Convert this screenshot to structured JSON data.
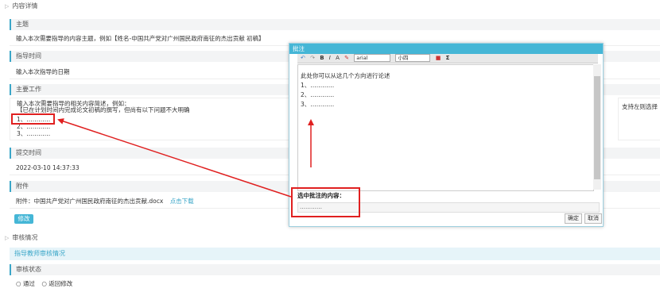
{
  "content_detail": {
    "section_title": "内容详情",
    "topic_label": "主题",
    "topic_value": "输入本次需要指导的内容主题，例如【姓名-中国共产党对广州国民政府南征的杰出贡献 初稿】",
    "guide_time_label": "指导时间",
    "guide_time_value": "输入本次指导的日期",
    "main_work_label": "主要工作",
    "main_work_lines": [
      "输入本次需要指导的相关内容简述，例如：",
      "【已在计划时间内完成论文初稿的撰写，但尚有以下问题不大明确",
      "1、…………",
      "2、…………",
      "3、…………"
    ],
    "side_note": "支持左则选择",
    "submit_time_label": "提交时间",
    "submit_time_value": "2022-03-10 14:37:33",
    "attachment_label": "附件",
    "attachment_prefix": "附件：中国共产党对广州国民政府南征的杰出贡献.docx",
    "attachment_link": "点击下载",
    "edit_button": "修改"
  },
  "review": {
    "section_title": "审核情况",
    "teacher_review_title": "指导教师审核情况",
    "status_label": "审核状态",
    "options": [
      "通过",
      "返回修改"
    ]
  },
  "dialog": {
    "title": "批注",
    "toolbar": {
      "undo": "↶",
      "redo": "↷",
      "bold": "B",
      "italic": "I",
      "font_color": "A",
      "highlight": "✎",
      "font_family": "arial",
      "font_size": "小四",
      "sigma": "Σ"
    },
    "editor_lines": [
      "此处你可以从这几个方向进行论述",
      "1、…………",
      "2、…………",
      "3、…………"
    ],
    "selected_label": "选中批注的内容：",
    "selected_value": "…………",
    "confirm": "确定",
    "cancel": "取消"
  },
  "colors": {
    "accent": "#45b6d6",
    "annotation_red": "#e02020"
  }
}
